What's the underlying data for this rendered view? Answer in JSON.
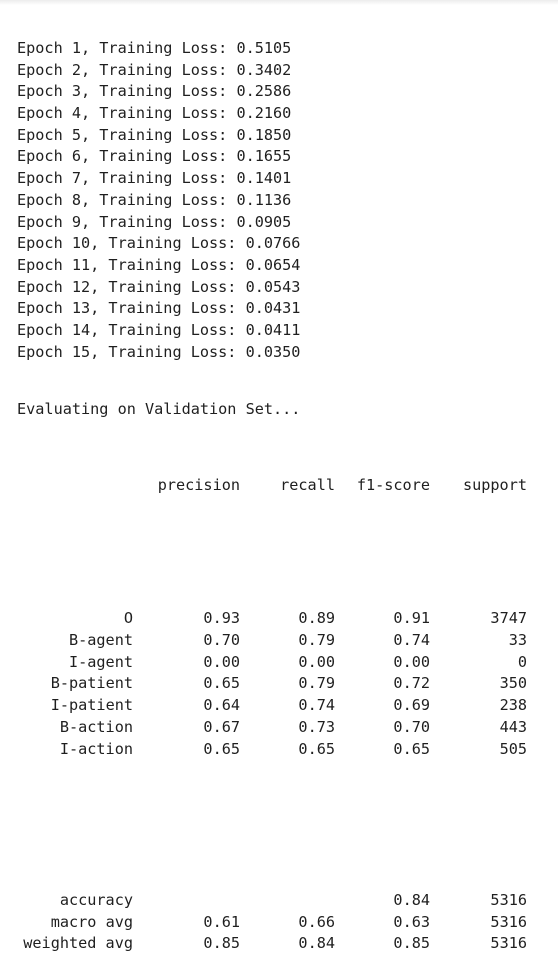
{
  "epochs": [
    "Epoch 1, Training Loss: 0.5105",
    "Epoch 2, Training Loss: 0.3402",
    "Epoch 3, Training Loss: 0.2586",
    "Epoch 4, Training Loss: 0.2160",
    "Epoch 5, Training Loss: 0.1850",
    "Epoch 6, Training Loss: 0.1655",
    "Epoch 7, Training Loss: 0.1401",
    "Epoch 8, Training Loss: 0.1136",
    "Epoch 9, Training Loss: 0.0905",
    "Epoch 10, Training Loss: 0.0766",
    "Epoch 11, Training Loss: 0.0654",
    "Epoch 12, Training Loss: 0.0543",
    "Epoch 13, Training Loss: 0.0431",
    "Epoch 14, Training Loss: 0.0411",
    "Epoch 15, Training Loss: 0.0350"
  ],
  "evaluating_line": "Evaluating on Validation Set...",
  "report": {
    "headers": {
      "precision": "precision",
      "recall": "recall",
      "f1": "f1-score",
      "support": "support"
    },
    "rows": [
      {
        "label": "O",
        "precision": "0.93",
        "recall": "0.89",
        "f1": "0.91",
        "support": "3747"
      },
      {
        "label": "B-agent",
        "precision": "0.70",
        "recall": "0.79",
        "f1": "0.74",
        "support": "33"
      },
      {
        "label": "I-agent",
        "precision": "0.00",
        "recall": "0.00",
        "f1": "0.00",
        "support": "0"
      },
      {
        "label": "B-patient",
        "precision": "0.65",
        "recall": "0.79",
        "f1": "0.72",
        "support": "350"
      },
      {
        "label": "I-patient",
        "precision": "0.64",
        "recall": "0.74",
        "f1": "0.69",
        "support": "238"
      },
      {
        "label": "B-action",
        "precision": "0.67",
        "recall": "0.73",
        "f1": "0.70",
        "support": "443"
      },
      {
        "label": "I-action",
        "precision": "0.65",
        "recall": "0.65",
        "f1": "0.65",
        "support": "505"
      }
    ],
    "summary": [
      {
        "label": "accuracy",
        "precision": "",
        "recall": "",
        "f1": "0.84",
        "support": "5316"
      },
      {
        "label": "macro avg",
        "precision": "0.61",
        "recall": "0.66",
        "f1": "0.63",
        "support": "5316"
      },
      {
        "label": "weighted avg",
        "precision": "0.85",
        "recall": "0.84",
        "f1": "0.85",
        "support": "5316"
      }
    ]
  }
}
